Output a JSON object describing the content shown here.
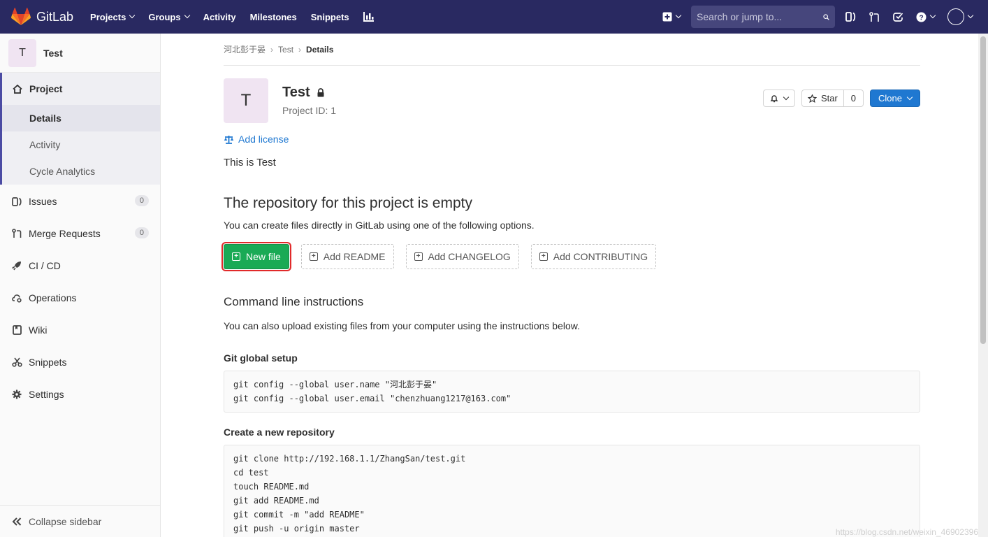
{
  "navbar": {
    "brand": "GitLab",
    "links": [
      {
        "label": "Projects",
        "dropdown": true
      },
      {
        "label": "Groups",
        "dropdown": true
      },
      {
        "label": "Activity",
        "dropdown": false
      },
      {
        "label": "Milestones",
        "dropdown": false
      },
      {
        "label": "Snippets",
        "dropdown": false
      }
    ],
    "search_placeholder": "Search or jump to...",
    "bg_color": "#292961"
  },
  "sidebar": {
    "avatar_letter": "T",
    "project_title": "Test",
    "project_section": "Project",
    "project_subitems": [
      "Details",
      "Activity",
      "Cycle Analytics"
    ],
    "items": [
      {
        "label": "Issues",
        "count": "0",
        "icon": "issues-icon"
      },
      {
        "label": "Merge Requests",
        "count": "0",
        "icon": "merge-request-icon"
      },
      {
        "label": "CI / CD",
        "icon": "rocket-icon"
      },
      {
        "label": "Operations",
        "icon": "cloud-gear-icon"
      },
      {
        "label": "Wiki",
        "icon": "book-icon"
      },
      {
        "label": "Snippets",
        "icon": "scissors-icon"
      },
      {
        "label": "Settings",
        "icon": "gear-icon"
      }
    ],
    "collapse_label": "Collapse sidebar"
  },
  "breadcrumb": {
    "group": "河北彭于晏",
    "project": "Test",
    "current": "Details"
  },
  "project": {
    "avatar_letter": "T",
    "name": "Test",
    "id_text": "Project ID: 1",
    "star_label": "Star",
    "star_count": "0",
    "clone_label": "Clone",
    "add_license": "Add license",
    "description": "This is Test"
  },
  "empty_repo": {
    "heading": "The repository for this project is empty",
    "text": "You can create files directly in GitLab using one of the following options.",
    "buttons": {
      "new_file": "New file",
      "readme": "Add README",
      "changelog": "Add CHANGELOG",
      "contributing": "Add CONTRIBUTING"
    }
  },
  "commands": {
    "heading": "Command line instructions",
    "text": "You can also upload existing files from your computer using the instructions below.",
    "global_setup_title": "Git global setup",
    "global_setup": [
      "git config --global user.name \"河北彭于晏\"",
      "git config --global user.email \"chenzhuang1217@163.com\""
    ],
    "new_repo_title": "Create a new repository",
    "new_repo": [
      "git clone http://192.168.1.1/ZhangSan/test.git",
      "cd test",
      "touch README.md",
      "git add README.md",
      "git commit -m \"add README\"",
      "git push -u origin master"
    ]
  },
  "watermark": "https://blog.csdn.net/weixin_46902396"
}
